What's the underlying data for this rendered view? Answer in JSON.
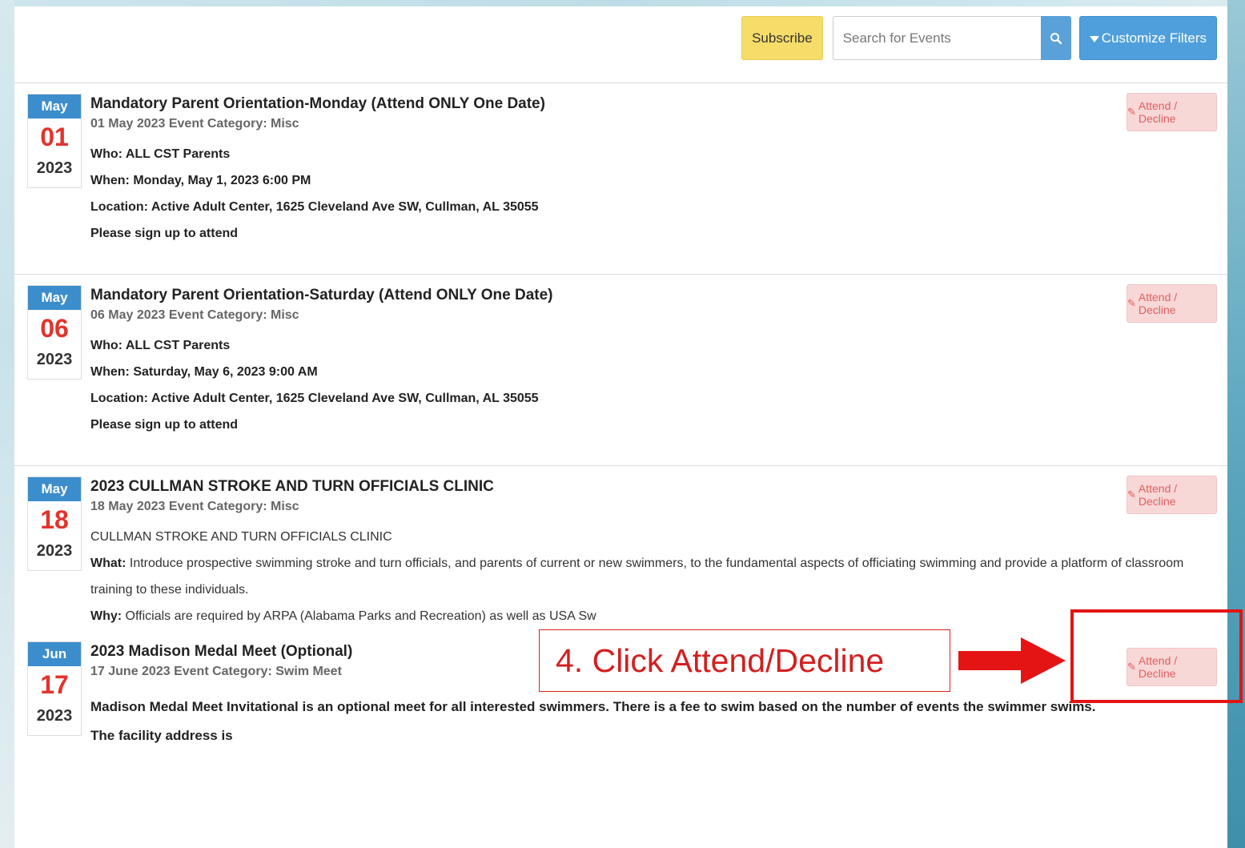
{
  "toolbar": {
    "subscribe_label": "Subscribe",
    "search_placeholder": "Search for Events",
    "filters_label": "Customize Filters"
  },
  "events": [
    {
      "month": "May",
      "day": "01",
      "year": "2023",
      "title": "Mandatory Parent Orientation-Monday (Attend ONLY One Date)",
      "meta": "01 May 2023 Event Category: Misc",
      "lines": [
        "Who: ALL CST Parents",
        "When: Monday, May 1, 2023  6:00 PM",
        "Location: Active Adult Center, 1625 Cleveland Ave SW, Cullman, AL 35055",
        "Please sign up to attend"
      ],
      "attend_label": "Attend / Decline"
    },
    {
      "month": "May",
      "day": "06",
      "year": "2023",
      "title": "Mandatory Parent Orientation-Saturday (Attend ONLY One Date)",
      "meta": "06 May 2023 Event Category: Misc",
      "lines": [
        "Who: ALL CST Parents",
        "When: Saturday, May 6, 2023  9:00 AM",
        "Location: Active Adult Center, 1625 Cleveland Ave SW, Cullman, AL 35055",
        "Please sign up to attend"
      ],
      "attend_label": "Attend / Decline"
    },
    {
      "month": "May",
      "day": "18",
      "year": "2023",
      "title": "2023 CULLMAN STROKE AND TURN OFFICIALS CLINIC",
      "meta": "18 May 2023 Event Category: Misc",
      "intro": "CULLMAN STROKE AND TURN OFFICIALS CLINIC",
      "what_label": "What:",
      "what_text": " Introduce prospective swimming stroke and turn officials, and parents of current or new swimmers, to the fundamental aspects of officiating swimming and provide a platform of classroom training to these individuals.",
      "why_label": "Why:",
      "why_text": " Officials are required by ARPA (Alabama Parks and Recreation) as well as USA Sw",
      "attend_label": "Attend / Decline"
    },
    {
      "month": "Jun",
      "day": "17",
      "year": "2023",
      "title": "2023 Madison Medal Meet (Optional)",
      "meta": "17 June 2023 Event Category: Swim Meet",
      "lines": [
        "Madison Medal Meet Invitational is an optional meet for all interested swimmers.  There is a fee to swim based on the number of events the swimmer swims.",
        "The facility address is"
      ],
      "attend_label": "Attend / Decline"
    }
  ],
  "annotation": {
    "text": "4. Click Attend/Decline",
    "color": "#d31f1f"
  }
}
